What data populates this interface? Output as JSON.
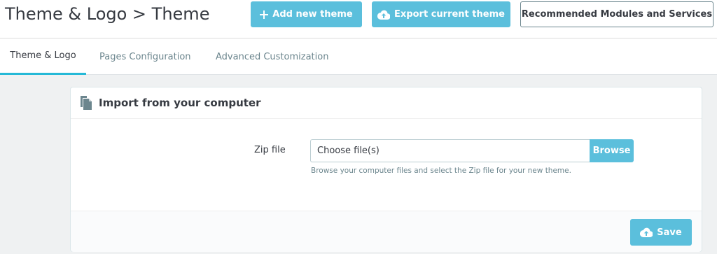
{
  "header": {
    "title": "Theme & Logo > Theme",
    "buttons": {
      "add_new_theme": "Add new theme",
      "export_current_theme": "Export current theme",
      "recommended": "Recommended Modules and Services"
    }
  },
  "tabs": [
    {
      "label": "Theme & Logo",
      "active": true
    },
    {
      "label": "Pages Configuration",
      "active": false
    },
    {
      "label": "Advanced Customization",
      "active": false
    }
  ],
  "panel": {
    "title": "Import from your computer",
    "zip_label": "Zip file",
    "file_placeholder": "Choose file(s)",
    "browse_label": "Browse",
    "help": "Browse your computer files and select the Zip file for your new theme.",
    "save_label": "Save"
  },
  "icons": {
    "add": "plus-icon",
    "export": "cloud-upload-icon",
    "panel": "file-copy-icon",
    "save": "cloud-upload-icon"
  },
  "colors": {
    "accent": "#5bbfdc",
    "active_tab_border": "#25b9d7",
    "text": "#363a41",
    "muted": "#6c868e",
    "background": "#eff1f2"
  }
}
